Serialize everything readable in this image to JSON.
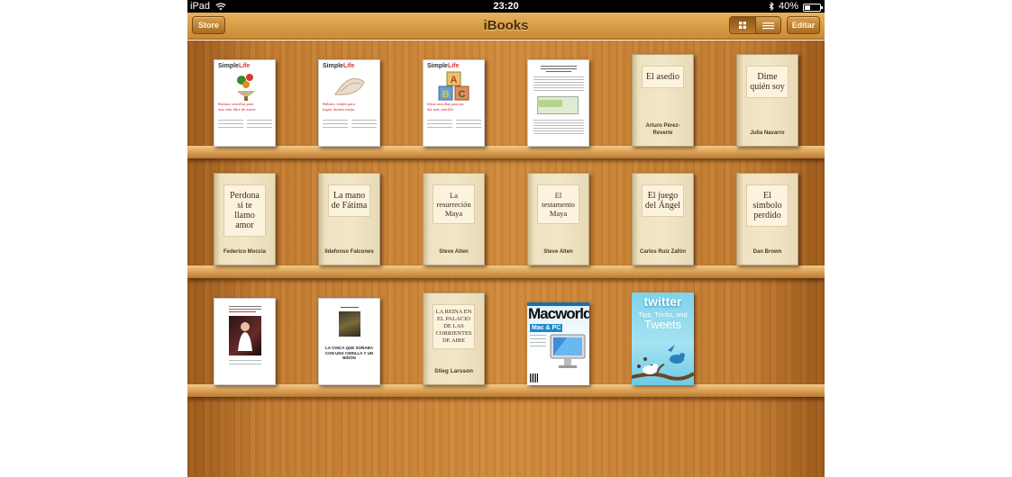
{
  "status_bar": {
    "device": "iPad",
    "time": "23:20",
    "battery": "40%",
    "battery_level": 0.4
  },
  "navbar": {
    "store_label": "Store",
    "title": "iBooks",
    "edit_label": "Editar"
  },
  "shelf_1": [
    {
      "type": "simplelife",
      "logo_a": "Simple",
      "logo_b": "Life",
      "text": "Rutinas sencillas para una vida libre de estrés"
    },
    {
      "type": "simplelife",
      "logo_a": "Simple",
      "logo_b": "Life",
      "text": "Hábitos vitales para lograr dormir mejor"
    },
    {
      "type": "simplelife",
      "logo_a": "Simple",
      "logo_b": "Life",
      "text": "Ideas sencillas para un día más sencillo"
    },
    {
      "type": "document"
    },
    {
      "type": "cloth",
      "title": "El asedio",
      "author": "Arturo Pérez-Reverte"
    },
    {
      "type": "cloth",
      "title": "Dime quién soy",
      "author": "Julia Navarro"
    }
  ],
  "shelf_2": [
    {
      "type": "cloth",
      "title": "Perdona si te llamo amor",
      "author": "Federico Moccia"
    },
    {
      "type": "cloth",
      "title": "La mano de Fátima",
      "author": "Ildefonso Falcones"
    },
    {
      "type": "cloth",
      "title": "La resurreción Maya",
      "author": "Steve Alten"
    },
    {
      "type": "cloth",
      "title": "El testamento Maya",
      "author": "Steve Alten"
    },
    {
      "type": "cloth",
      "title": "El juego del Ángel",
      "author": "Carlos Ruiz Zafón"
    },
    {
      "type": "cloth",
      "title": "El símbolo perdido",
      "author": "Dan Brown"
    }
  ],
  "shelf_3": [
    {
      "type": "photo-doc"
    },
    {
      "type": "photo-doc-2",
      "title": "LA CHICA QUE SOÑABA CON UNA CERILLA Y UN BIDÓN"
    },
    {
      "type": "cloth",
      "title": "LA REINA EN EL PALACIO DE LAS CORRIENTES DE AIRE",
      "author": "Stieg Larsson"
    },
    {
      "type": "macworld",
      "logo": "Macworld",
      "sub": "Mac & PC"
    },
    {
      "type": "twitter",
      "title": "twitter",
      "sub": "Tips, Tricks, and",
      "tweets": "Tweets"
    }
  ]
}
